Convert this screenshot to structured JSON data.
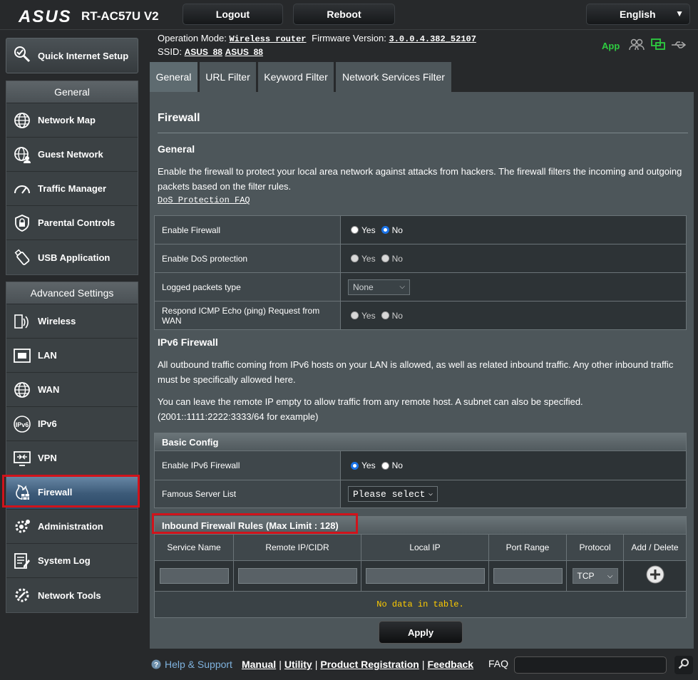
{
  "brand": {
    "logo": "ASUS",
    "model": "RT-AC57U V2"
  },
  "topbar": {
    "logout": "Logout",
    "reboot": "Reboot",
    "language": "English"
  },
  "status": {
    "op_mode_label": "Operation Mode:",
    "op_mode_value": "Wireless router",
    "fw_label": "Firmware Version:",
    "fw_value": "3.0.0.4.382_52107",
    "ssid_label": "SSID:",
    "ssid_1": "ASUS_88",
    "ssid_2": "ASUS_88",
    "app": "App"
  },
  "sidebar": {
    "qis": "Quick Internet Setup",
    "general_head": "General",
    "general_items": [
      "Network Map",
      "Guest Network",
      "Traffic Manager",
      "Parental Controls",
      "USB Application"
    ],
    "advanced_head": "Advanced Settings",
    "advanced_items": [
      "Wireless",
      "LAN",
      "WAN",
      "IPv6",
      "VPN",
      "Firewall",
      "Administration",
      "System Log",
      "Network Tools"
    ],
    "active": "Firewall"
  },
  "tabs": [
    "General",
    "URL Filter",
    "Keyword Filter",
    "Network Services Filter"
  ],
  "content": {
    "title": "Firewall",
    "general_head": "General",
    "general_desc": "Enable the firewall to protect your local area network against attacks from hackers. The firewall filters the incoming and outgoing packets based on the filter rules.",
    "faq_link": "DoS Protection FAQ",
    "settings": {
      "enable_firewall": "Enable Firewall",
      "enable_dos": "Enable DoS protection",
      "logged_packets": "Logged packets type",
      "logged_value": "None",
      "icmp_label": "Respond ICMP Echo (ping) Request from WAN",
      "yes": "Yes",
      "no": "No"
    },
    "ipv6_head": "IPv6 Firewall",
    "ipv6_desc1": "All outbound traffic coming from IPv6 hosts on your LAN is allowed, as well as related inbound traffic. Any other inbound traffic must be specifically allowed here.",
    "ipv6_desc2": "You can leave the remote IP empty to allow traffic from any remote host. A subnet can also be specified. (2001::1111:2222:3333/64 for example)",
    "basic_config": "Basic Config",
    "enable_ipv6_fw": "Enable IPv6 Firewall",
    "famous_server": "Famous Server List",
    "famous_value": "Please select",
    "inbound_head": "Inbound Firewall Rules (Max Limit : 128)",
    "columns": [
      "Service Name",
      "Remote IP/CIDR",
      "Local IP",
      "Port Range",
      "Protocol",
      "Add / Delete"
    ],
    "protocol_value": "TCP",
    "no_data": "No data in table.",
    "apply": "Apply"
  },
  "footer": {
    "help": "Help & Support",
    "manual": "Manual",
    "utility": "Utility",
    "registration": "Product Registration",
    "feedback": "Feedback",
    "faq": "FAQ"
  },
  "colors": {
    "highlight": "#d0131b",
    "accent_green": "#2ecc40",
    "radio_blue": "#1a73e8",
    "nodata_yellow": "#ffcc00"
  }
}
